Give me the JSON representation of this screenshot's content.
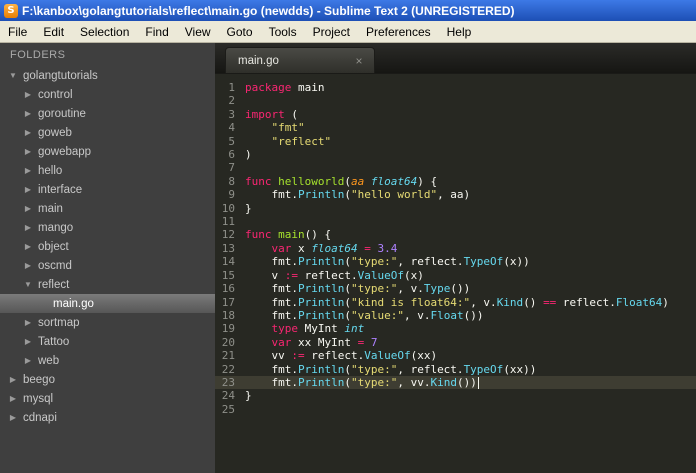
{
  "window": {
    "title": "F:\\kanbox\\golangtutorials\\reflect\\main.go (newdds) - Sublime Text 2 (UNREGISTERED)",
    "app_icon_letter": "S"
  },
  "menu": {
    "items": [
      "File",
      "Edit",
      "Selection",
      "Find",
      "View",
      "Goto",
      "Tools",
      "Project",
      "Preferences",
      "Help"
    ]
  },
  "sidebar": {
    "header": "FOLDERS",
    "items": [
      {
        "label": "golangtutorials",
        "level": 0,
        "type": "folder",
        "state": "expanded",
        "selected": false
      },
      {
        "label": "control",
        "level": 1,
        "type": "folder",
        "state": "collapsed",
        "selected": false
      },
      {
        "label": "goroutine",
        "level": 1,
        "type": "folder",
        "state": "collapsed",
        "selected": false
      },
      {
        "label": "goweb",
        "level": 1,
        "type": "folder",
        "state": "collapsed",
        "selected": false
      },
      {
        "label": "gowebapp",
        "level": 1,
        "type": "folder",
        "state": "collapsed",
        "selected": false
      },
      {
        "label": "hello",
        "level": 1,
        "type": "folder",
        "state": "collapsed",
        "selected": false
      },
      {
        "label": "interface",
        "level": 1,
        "type": "folder",
        "state": "collapsed",
        "selected": false
      },
      {
        "label": "main",
        "level": 1,
        "type": "folder",
        "state": "collapsed",
        "selected": false
      },
      {
        "label": "mango",
        "level": 1,
        "type": "folder",
        "state": "collapsed",
        "selected": false
      },
      {
        "label": "object",
        "level": 1,
        "type": "folder",
        "state": "collapsed",
        "selected": false
      },
      {
        "label": "oscmd",
        "level": 1,
        "type": "folder",
        "state": "collapsed",
        "selected": false
      },
      {
        "label": "reflect",
        "level": 1,
        "type": "folder",
        "state": "expanded",
        "selected": false
      },
      {
        "label": "main.go",
        "level": 2,
        "type": "file",
        "state": "none",
        "selected": true
      },
      {
        "label": "sortmap",
        "level": 1,
        "type": "folder",
        "state": "collapsed",
        "selected": false
      },
      {
        "label": "Tattoo",
        "level": 1,
        "type": "folder",
        "state": "collapsed",
        "selected": false
      },
      {
        "label": "web",
        "level": 1,
        "type": "folder",
        "state": "collapsed",
        "selected": false
      },
      {
        "label": "beego",
        "level": 0,
        "type": "folder",
        "state": "collapsed",
        "selected": false
      },
      {
        "label": "mysql",
        "level": 0,
        "type": "folder",
        "state": "collapsed",
        "selected": false
      },
      {
        "label": "cdnapi",
        "level": 0,
        "type": "folder",
        "state": "collapsed",
        "selected": false
      }
    ]
  },
  "tabbar": {
    "tabs": [
      {
        "label": "main.go",
        "active": true,
        "close_glyph": "×"
      }
    ]
  },
  "editor": {
    "language": "go",
    "current_line": 23,
    "lines": [
      {
        "num": 1,
        "tokens": [
          [
            "kw",
            "package"
          ],
          [
            "pl",
            " main"
          ]
        ]
      },
      {
        "num": 2,
        "tokens": []
      },
      {
        "num": 3,
        "tokens": [
          [
            "kw",
            "import"
          ],
          [
            "pl",
            " ("
          ]
        ]
      },
      {
        "num": 4,
        "tokens": [
          [
            "pl",
            "    "
          ],
          [
            "str",
            "\"fmt\""
          ]
        ]
      },
      {
        "num": 5,
        "tokens": [
          [
            "pl",
            "    "
          ],
          [
            "str",
            "\"reflect\""
          ]
        ]
      },
      {
        "num": 6,
        "tokens": [
          [
            "pl",
            ")"
          ]
        ]
      },
      {
        "num": 7,
        "tokens": []
      },
      {
        "num": 8,
        "tokens": [
          [
            "kw",
            "func"
          ],
          [
            "pl",
            " "
          ],
          [
            "def",
            "helloworld"
          ],
          [
            "pl",
            "("
          ],
          [
            "par",
            "aa"
          ],
          [
            "pl",
            " "
          ],
          [
            "typ",
            "float64"
          ],
          [
            "pl",
            ") {"
          ]
        ]
      },
      {
        "num": 9,
        "tokens": [
          [
            "pl",
            "    fmt."
          ],
          [
            "fn",
            "Println"
          ],
          [
            "pl",
            "("
          ],
          [
            "str",
            "\"hello world\""
          ],
          [
            "pl",
            ", aa)"
          ]
        ]
      },
      {
        "num": 10,
        "tokens": [
          [
            "pl",
            "}"
          ]
        ]
      },
      {
        "num": 11,
        "tokens": []
      },
      {
        "num": 12,
        "tokens": [
          [
            "kw",
            "func"
          ],
          [
            "pl",
            " "
          ],
          [
            "def",
            "main"
          ],
          [
            "pl",
            "() {"
          ]
        ]
      },
      {
        "num": 13,
        "tokens": [
          [
            "pl",
            "    "
          ],
          [
            "kw",
            "var"
          ],
          [
            "pl",
            " x "
          ],
          [
            "typ",
            "float64"
          ],
          [
            "pl",
            " "
          ],
          [
            "kw",
            "="
          ],
          [
            "pl",
            " "
          ],
          [
            "num",
            "3.4"
          ]
        ]
      },
      {
        "num": 14,
        "tokens": [
          [
            "pl",
            "    fmt."
          ],
          [
            "fn",
            "Println"
          ],
          [
            "pl",
            "("
          ],
          [
            "str",
            "\"type:\""
          ],
          [
            "pl",
            ", reflect."
          ],
          [
            "fn",
            "TypeOf"
          ],
          [
            "pl",
            "(x))"
          ]
        ]
      },
      {
        "num": 15,
        "tokens": [
          [
            "pl",
            "    v "
          ],
          [
            "kw",
            ":="
          ],
          [
            "pl",
            " reflect."
          ],
          [
            "fn",
            "ValueOf"
          ],
          [
            "pl",
            "(x)"
          ]
        ]
      },
      {
        "num": 16,
        "tokens": [
          [
            "pl",
            "    fmt."
          ],
          [
            "fn",
            "Println"
          ],
          [
            "pl",
            "("
          ],
          [
            "str",
            "\"type:\""
          ],
          [
            "pl",
            ", v."
          ],
          [
            "fn",
            "Type"
          ],
          [
            "pl",
            "())"
          ]
        ]
      },
      {
        "num": 17,
        "tokens": [
          [
            "pl",
            "    fmt."
          ],
          [
            "fn",
            "Println"
          ],
          [
            "pl",
            "("
          ],
          [
            "str",
            "\"kind is float64:\""
          ],
          [
            "pl",
            ", v."
          ],
          [
            "fn",
            "Kind"
          ],
          [
            "pl",
            "() "
          ],
          [
            "kw",
            "=="
          ],
          [
            "pl",
            " reflect."
          ],
          [
            "fn",
            "Float64"
          ],
          [
            "pl",
            ")"
          ]
        ]
      },
      {
        "num": 18,
        "tokens": [
          [
            "pl",
            "    fmt."
          ],
          [
            "fn",
            "Println"
          ],
          [
            "pl",
            "("
          ],
          [
            "str",
            "\"value:\""
          ],
          [
            "pl",
            ", v."
          ],
          [
            "fn",
            "Float"
          ],
          [
            "pl",
            "())"
          ]
        ]
      },
      {
        "num": 19,
        "tokens": [
          [
            "pl",
            "    "
          ],
          [
            "kw",
            "type"
          ],
          [
            "pl",
            " MyInt "
          ],
          [
            "typ",
            "int"
          ]
        ]
      },
      {
        "num": 20,
        "tokens": [
          [
            "pl",
            "    "
          ],
          [
            "kw",
            "var"
          ],
          [
            "pl",
            " xx MyInt "
          ],
          [
            "kw",
            "="
          ],
          [
            "pl",
            " "
          ],
          [
            "num",
            "7"
          ]
        ]
      },
      {
        "num": 21,
        "tokens": [
          [
            "pl",
            "    vv "
          ],
          [
            "kw",
            ":="
          ],
          [
            "pl",
            " reflect."
          ],
          [
            "fn",
            "ValueOf"
          ],
          [
            "pl",
            "(xx)"
          ]
        ]
      },
      {
        "num": 22,
        "tokens": [
          [
            "pl",
            "    fmt."
          ],
          [
            "fn",
            "Println"
          ],
          [
            "pl",
            "("
          ],
          [
            "str",
            "\"type:\""
          ],
          [
            "pl",
            ", reflect."
          ],
          [
            "fn",
            "TypeOf"
          ],
          [
            "pl",
            "(xx))"
          ]
        ]
      },
      {
        "num": 23,
        "tokens": [
          [
            "pl",
            "    fmt."
          ],
          [
            "fn",
            "Println"
          ],
          [
            "pl",
            "("
          ],
          [
            "str",
            "\"type:\""
          ],
          [
            "pl",
            ", vv."
          ],
          [
            "fn",
            "Kind"
          ],
          [
            "pl",
            "())"
          ]
        ]
      },
      {
        "num": 24,
        "tokens": [
          [
            "pl",
            "}"
          ]
        ]
      },
      {
        "num": 25,
        "tokens": []
      }
    ]
  },
  "colors": {
    "editor-bg": "#272822",
    "sidebar-bg": "#3f3f3f",
    "accent-kw": "#f92672",
    "accent-fn": "#66d9ef",
    "accent-def": "#a6e22e",
    "accent-str": "#e6db74",
    "accent-num": "#ae81ff",
    "accent-par": "#fd971f",
    "fg": "#f8f8f2"
  }
}
